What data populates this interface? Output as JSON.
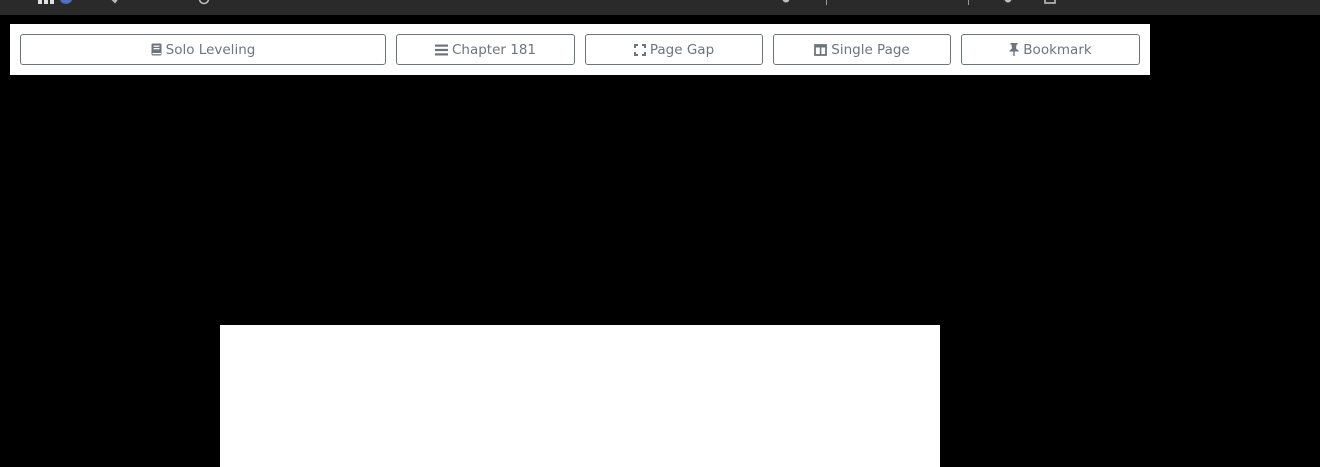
{
  "toolbar": {
    "series_label": "Solo Leveling",
    "chapter_label": "Chapter 181",
    "page_gap_label": "Page Gap",
    "single_page_label": "Single Page",
    "bookmark_label": "Bookmark"
  },
  "icons": {
    "series": "book-icon",
    "chapter": "list-icon",
    "page_gap": "expand-icon",
    "single_page": "columns-icon",
    "bookmark": "pin-icon"
  },
  "colors": {
    "button_text": "#6c757d",
    "background": "#000000",
    "toolbar_bg": "#ffffff",
    "topbar_bg": "#2a2a2a"
  }
}
